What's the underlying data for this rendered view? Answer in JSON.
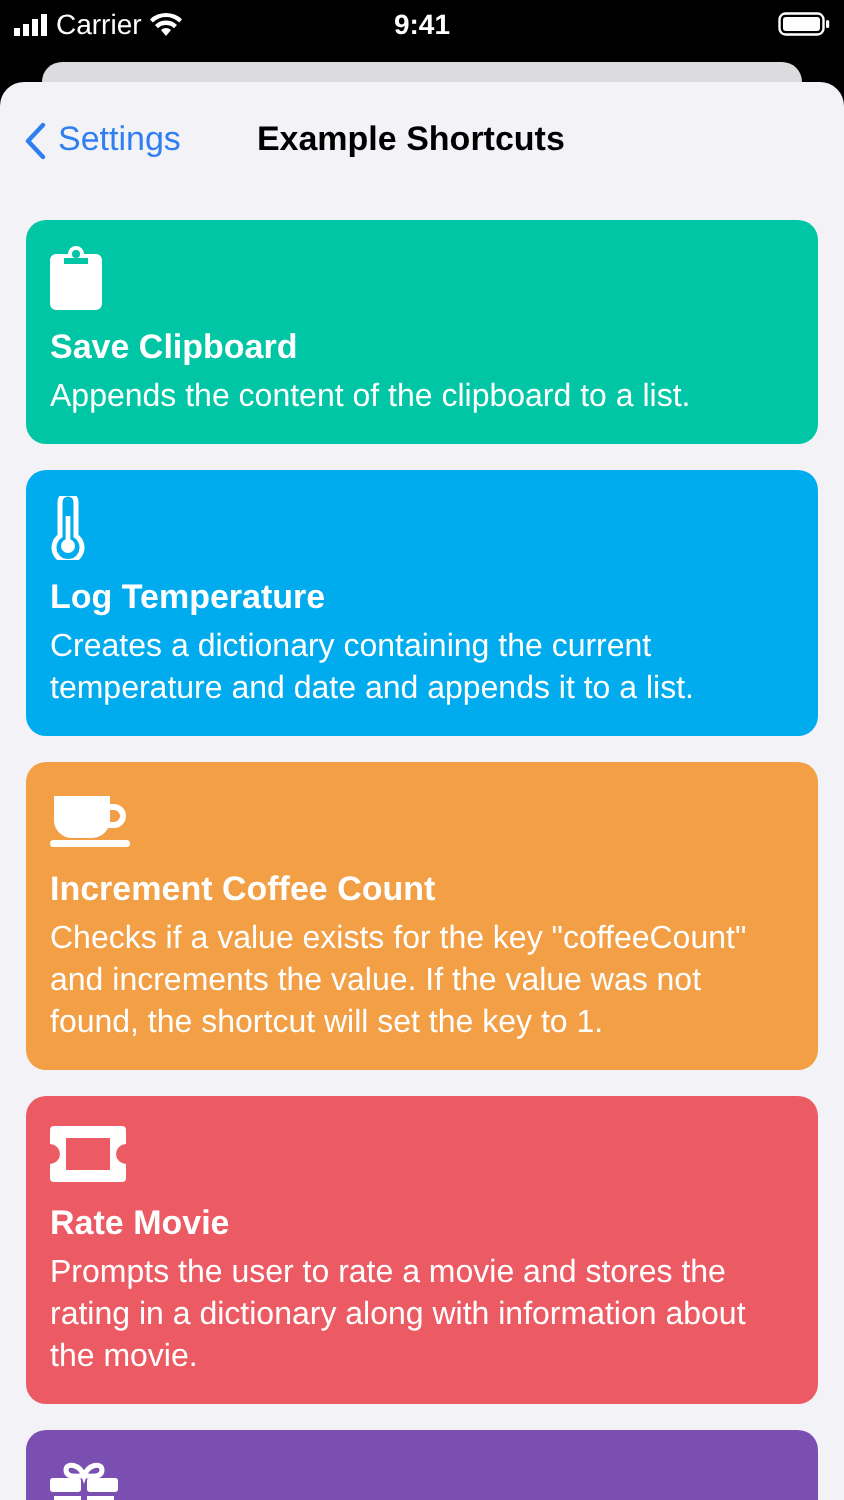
{
  "status_bar": {
    "carrier": "Carrier",
    "time": "9:41"
  },
  "nav": {
    "back": "Settings",
    "title": "Example Shortcuts"
  },
  "cards": [
    {
      "kind": "clipboard",
      "color": "#00c6a5",
      "title": "Save Clipboard",
      "description": "Appends the content of the clipboard to a list."
    },
    {
      "kind": "thermometer",
      "color": "#00abee",
      "title": "Log Temperature",
      "description": "Creates a dictionary containing the current temperature and date and appends it to a list."
    },
    {
      "kind": "cup",
      "color": "#f29f45",
      "title": "Increment Coffee Count",
      "description": "Checks if a value exists for the key \"coffeeCount\" and increments the value. If the value was not found, the shortcut will set the key to 1."
    },
    {
      "kind": "ticket",
      "color": "#ec5b64",
      "title": "Rate Movie",
      "description": "Prompts the user to rate a movie and stores the rating in a dictionary along with information about the movie."
    },
    {
      "kind": "gift",
      "color": "#7b4fb2"
    }
  ]
}
